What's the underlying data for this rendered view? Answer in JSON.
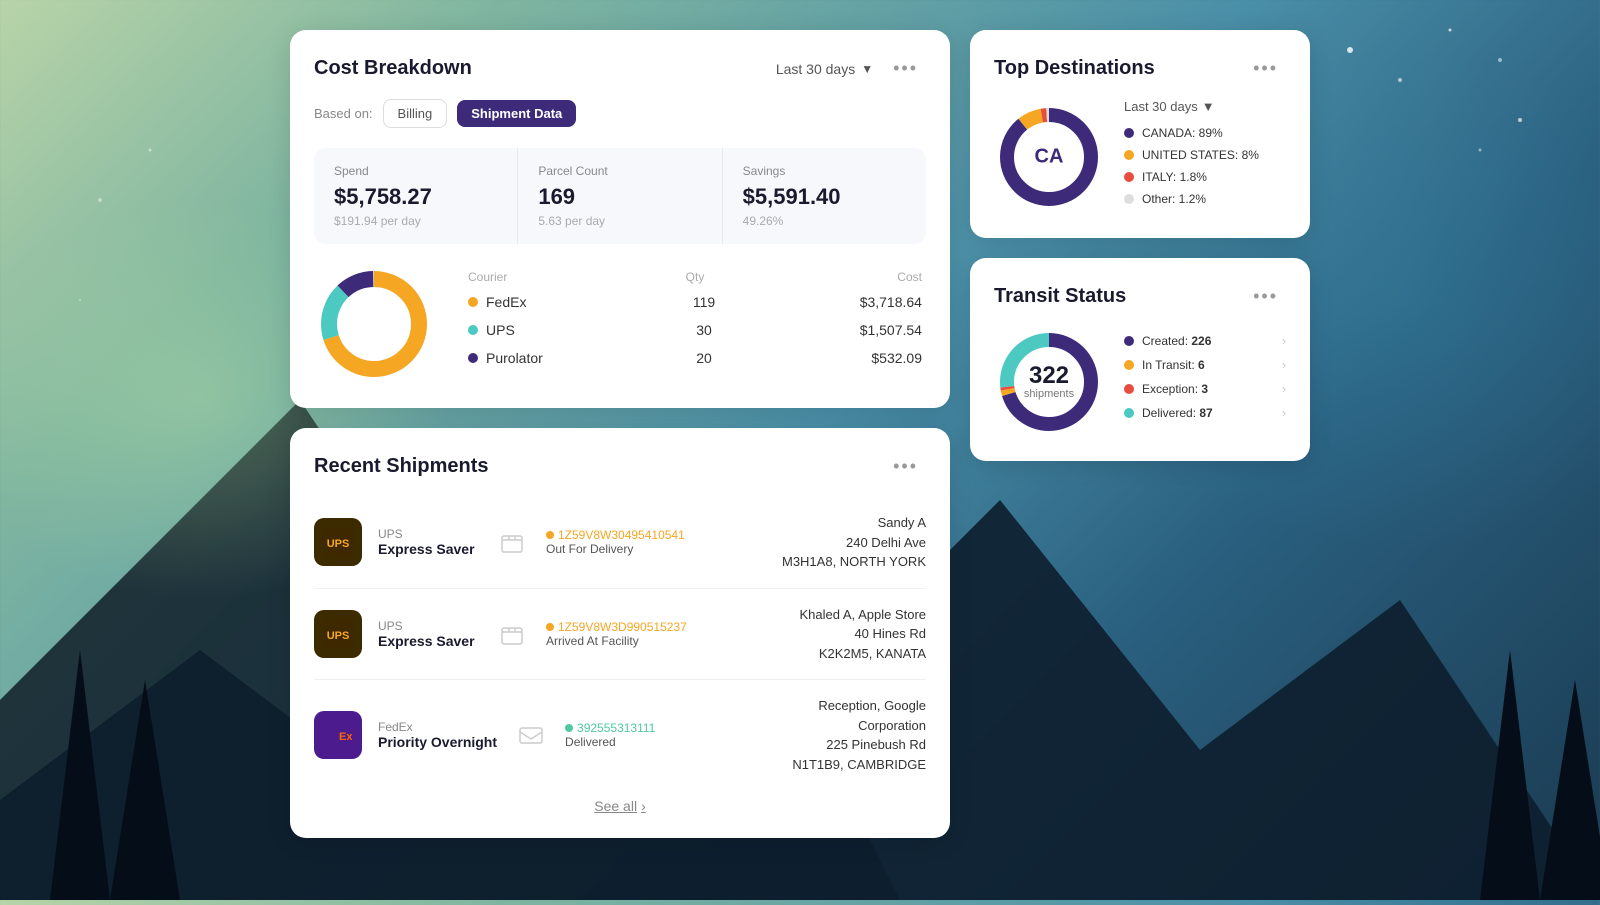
{
  "background": {
    "description": "Night sky with mountains and trees"
  },
  "cost_breakdown": {
    "title": "Cost Breakdown",
    "time_filter": "Last 30 days",
    "based_on_label": "Based on:",
    "tab_billing": "Billing",
    "tab_shipment": "Shipment Data",
    "metrics": {
      "spend": {
        "label": "Spend",
        "value": "$5,758.27",
        "sub": "$191.94 per day"
      },
      "parcel_count": {
        "label": "Parcel Count",
        "value": "169",
        "sub": "5.63 per day"
      },
      "savings": {
        "label": "Savings",
        "value": "$5,591.40",
        "sub": "49.26%"
      }
    },
    "couriers": {
      "header": {
        "col1": "Courier",
        "col2": "Qty",
        "col3": "Cost"
      },
      "rows": [
        {
          "name": "FedEx",
          "qty": "119",
          "cost": "$3,718.64",
          "color": "#f5a623"
        },
        {
          "name": "UPS",
          "qty": "30",
          "cost": "$1,507.54",
          "color": "#4cc9c0"
        },
        {
          "name": "Purolator",
          "qty": "20",
          "cost": "$532.09",
          "color": "#3d2b7a"
        }
      ]
    },
    "more_label": "•••"
  },
  "recent_shipments": {
    "title": "Recent Shipments",
    "more_label": "•••",
    "see_all": "See all",
    "rows": [
      {
        "carrier": "UPS",
        "carrier_type": "ups",
        "service": "Express Saver",
        "tracking": "1Z59V8W30495410541",
        "status": "Out For Delivery",
        "status_color": "#f5a623",
        "recipient_line1": "Sandy A",
        "recipient_line2": "240 Delhi Ave",
        "recipient_line3": "M3H1A8, NORTH YORK",
        "icon_type": "box"
      },
      {
        "carrier": "UPS",
        "carrier_type": "ups",
        "service": "Express Saver",
        "tracking": "1Z59V8W3D990515237",
        "status": "Arrived At Facility",
        "status_color": "#f5a623",
        "recipient_line1": "Khaled A, Apple Store",
        "recipient_line2": "40 Hines Rd",
        "recipient_line3": "K2K2M5, KANATA",
        "icon_type": "box"
      },
      {
        "carrier": "FedEx",
        "carrier_type": "fedex",
        "service": "Priority Overnight",
        "tracking": "392555313111",
        "status": "Delivered",
        "status_color": "#4cc9a0",
        "recipient_line1": "Reception, Google",
        "recipient_line2": "Corporation",
        "recipient_line3": "225 Pinebush Rd",
        "recipient_line4": "N1T1B9, CAMBRIDGE",
        "icon_type": "envelope"
      }
    ]
  },
  "top_destinations": {
    "title": "Top Destinations",
    "more_label": "•••",
    "time_filter": "Last 30 days",
    "center_text": "CA",
    "legend": [
      {
        "label": "CANADA: 89%",
        "color": "#3d2b7a"
      },
      {
        "label": "UNITED STATES: 8%",
        "color": "#f5a623"
      },
      {
        "label": "ITALY: 1.8%",
        "color": "#e74c3c"
      },
      {
        "label": "Other: 1.2%",
        "color": "#ddd"
      }
    ],
    "chart": {
      "canada_pct": 89,
      "us_pct": 8,
      "italy_pct": 1.8,
      "other_pct": 1.2
    }
  },
  "transit_status": {
    "title": "Transit Status",
    "more_label": "•••",
    "center_number": "322",
    "center_label": "shipments",
    "legend": [
      {
        "label": "Created:",
        "value": "226",
        "color": "#3d2b7a"
      },
      {
        "label": "In Transit:",
        "value": "6",
        "color": "#f5a623"
      },
      {
        "label": "Exception:",
        "value": "3",
        "color": "#e74c3c"
      },
      {
        "label": "Delivered:",
        "value": "87",
        "color": "#4cc9c0"
      }
    ],
    "chart": {
      "created_pct": 226,
      "in_transit_pct": 6,
      "exception_pct": 3,
      "delivered_pct": 87
    }
  }
}
